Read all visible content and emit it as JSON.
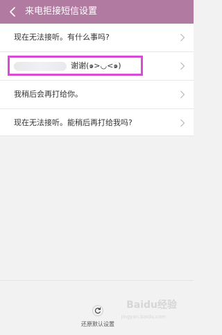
{
  "header": {
    "title": "来电拒接短信设置",
    "back_icon": "chevron-left-icon"
  },
  "messages": [
    {
      "text": "现在无法接听。有什么事吗?"
    },
    {
      "text": "谢谢(๑>◡<๑)"
    },
    {
      "text": "我稍后会再打给你。"
    },
    {
      "text": "现在无法接听。能稍后再打给我吗?"
    }
  ],
  "footer": {
    "reset_label": "还原默认设置",
    "reset_icon": "refresh-icon"
  },
  "watermark": {
    "text": "Baidu经验",
    "sub": "jingyan.baidu.com"
  },
  "colors": {
    "header": "#b07aa1",
    "highlight": "#d84bd6"
  }
}
